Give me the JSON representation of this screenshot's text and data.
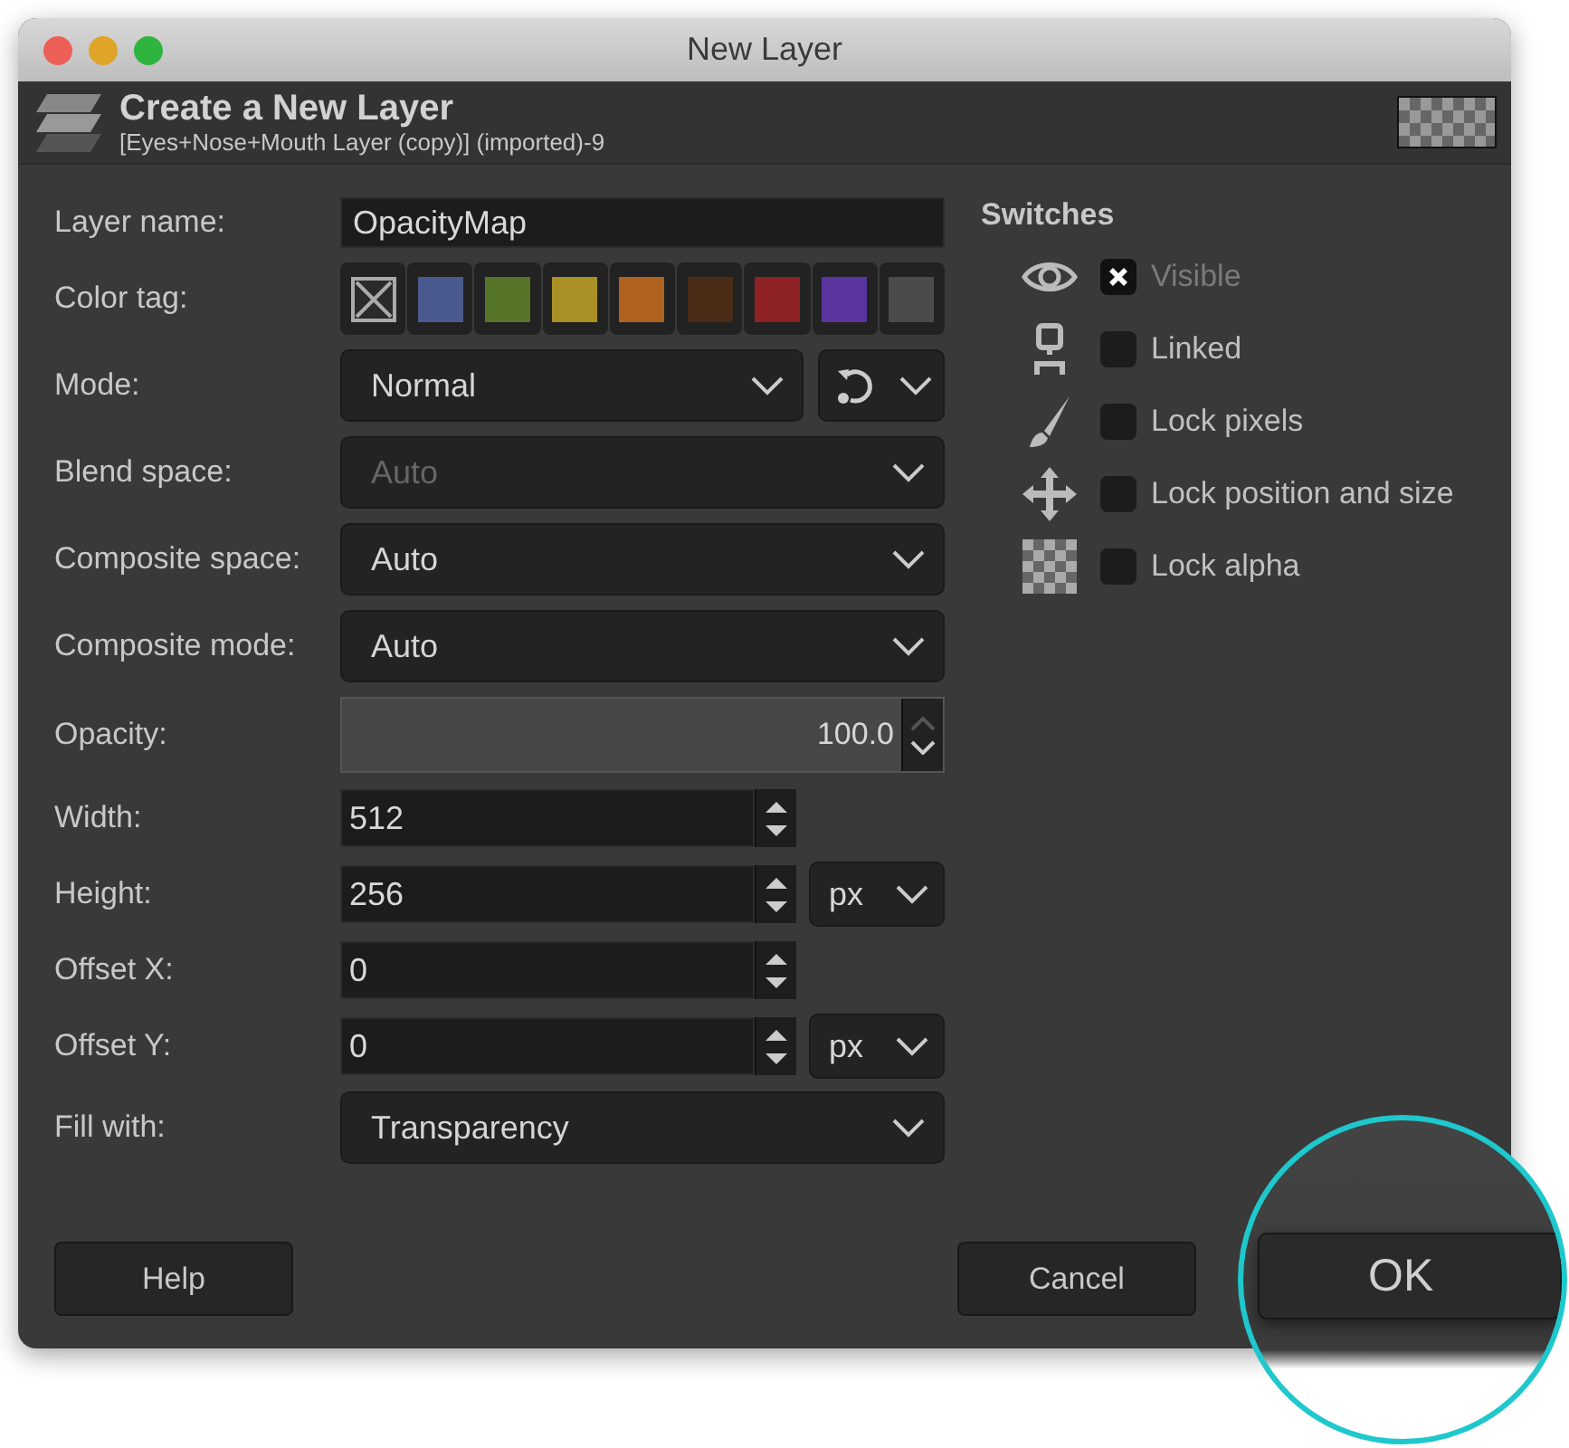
{
  "window": {
    "title": "New Layer"
  },
  "header": {
    "title": "Create a New Layer",
    "subtitle": "[Eyes+Nose+Mouth Layer (copy)] (imported)-9"
  },
  "fields": [
    {
      "kind": "text",
      "label": "Layer name:",
      "value": "OpacityMap"
    },
    {
      "kind": "colors",
      "label": "Color tag:",
      "tags": [
        {
          "color": "#2a2a2a",
          "none": true
        },
        {
          "color": "#4a5a8e",
          "none": false
        },
        {
          "color": "#577528",
          "none": false
        },
        {
          "color": "#a99126",
          "none": false
        },
        {
          "color": "#b0621f",
          "none": false
        },
        {
          "color": "#4a2c17",
          "none": false
        },
        {
          "color": "#8e2224",
          "none": false
        },
        {
          "color": "#5a35a0",
          "none": false
        },
        {
          "color": "#4b4b4b",
          "none": false
        }
      ]
    },
    {
      "kind": "mode",
      "label": "Mode:",
      "value": "Normal",
      "disabled": false
    },
    {
      "kind": "dropdown",
      "label": "Blend space:",
      "value": "Auto",
      "disabled": true
    },
    {
      "kind": "dropdown",
      "label": "Composite space:",
      "value": "Auto",
      "disabled": false
    },
    {
      "kind": "dropdown",
      "label": "Composite mode:",
      "value": "Auto",
      "disabled": false
    },
    {
      "kind": "slider",
      "label": "Opacity:",
      "value": "100.0",
      "level": 1.0
    },
    {
      "kind": "spin",
      "label": "Width:",
      "value": "512"
    },
    {
      "kind": "spin",
      "label": "Height:",
      "value": "256",
      "unit": "px"
    },
    {
      "kind": "spin",
      "label": "Offset X:",
      "value": "0"
    },
    {
      "kind": "spin",
      "label": "Offset Y:",
      "value": "0",
      "unit": "px"
    },
    {
      "kind": "dropdown",
      "label": "Fill with:",
      "value": "Transparency",
      "disabled": false
    }
  ],
  "switches": {
    "title": "Switches",
    "items": [
      {
        "label": "Visible",
        "checked": true,
        "disabled": true
      },
      {
        "label": "Linked",
        "checked": false,
        "disabled": false
      },
      {
        "label": "Lock pixels",
        "checked": false,
        "disabled": false
      },
      {
        "label": "Lock position and size",
        "checked": false,
        "disabled": false
      },
      {
        "label": "Lock alpha",
        "checked": false,
        "disabled": false
      }
    ]
  },
  "buttons": [
    {
      "label": "Help",
      "magnified": false
    },
    {
      "label": "Cancel",
      "magnified": false
    },
    {
      "label": "OK",
      "magnified": true
    }
  ]
}
